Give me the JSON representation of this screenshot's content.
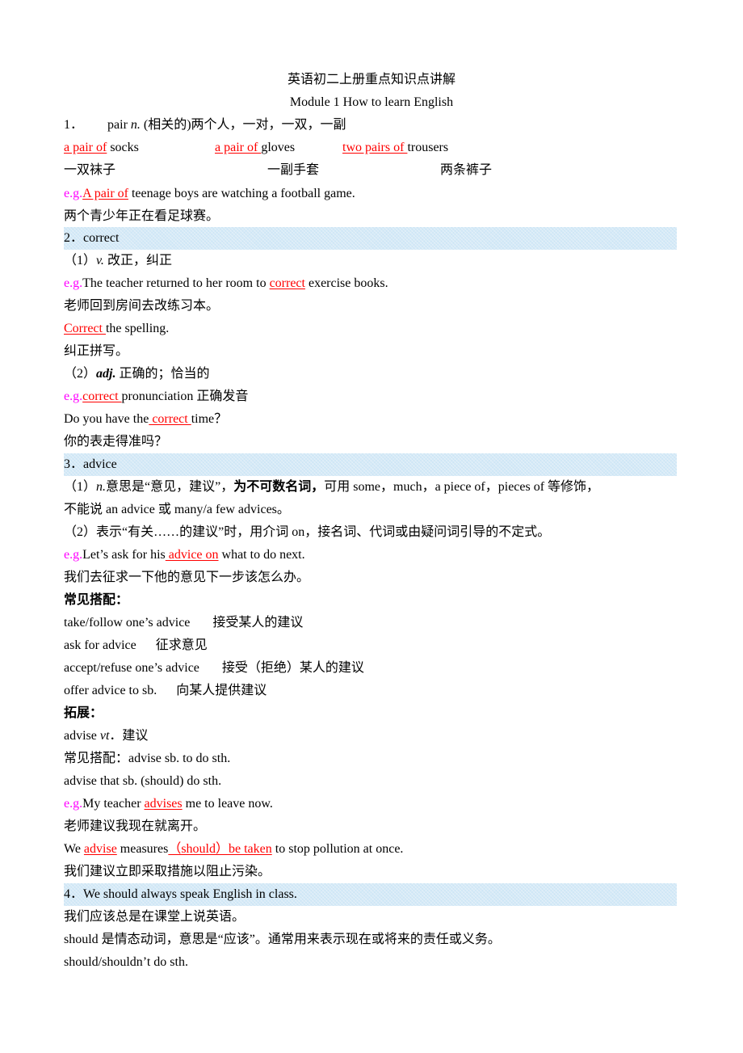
{
  "doc": {
    "title": "英语初二上册重点知识点讲解",
    "subtitle": "Module 1 How to learn English"
  },
  "s1": {
    "num": "1．",
    "word": "pair",
    "pos": "n.",
    "meaning": " (相关的)两个人，一对，一双，一副",
    "ex1_red": "a pair of",
    "ex1_tail": " socks",
    "ex2_red": "a pair of ",
    "ex2_tail": "gloves",
    "ex3_red": "two pairs of ",
    "ex3_tail": "trousers",
    "cn1": "一双袜子",
    "cn2": "一副手套",
    "cn3": "两条裤子",
    "eg": "e.g.",
    "eg_red": "A pair of",
    "eg_tail": " teenage boys are watching a football game.",
    "eg_cn": "两个青少年正在看足球赛。"
  },
  "s2": {
    "header": "2．correct",
    "p1_prefix": "（1）",
    "p1_pos": "v.",
    "p1_meaning": " 改正，纠正",
    "eg": "e.g.",
    "ex1_head": "The teacher returned to her room to ",
    "ex1_red": "correct",
    "ex1_tail": " exercise books.",
    "ex1_cn": "老师回到房间去改练习本。",
    "ex2_red": "Correct ",
    "ex2_tail": "the spelling.",
    "ex2_cn": "纠正拼写。",
    "p2_prefix": "（2）",
    "p2_pos": "adj.",
    "p2_meaning": " 正确的；恰当的",
    "ex3_red": "correct ",
    "ex3_tail": "pronunciation  正确发音",
    "ex4_head": "Do you have the",
    "ex4_red": " correct ",
    "ex4_tail": "time？",
    "ex4_cn": "你的表走得准吗？"
  },
  "s3": {
    "header": "3．advice",
    "p1_prefix": "（1）",
    "p1_pos": "n.",
    "p1_a": "意思是“意见，建议”，",
    "p1_bold": "为不可数名词，",
    "p1_b": "可用 some，much，a piece of，pieces of 等修饰，",
    "p1_c": "不能说 an advice 或 many/a few advices。",
    "p2": "（2）表示“有关……的建议”时，用介词 on，接名词、代词或由疑问词引导的不定式。",
    "eg": "e.g.",
    "ex1_head": "Let’s ask for his",
    "ex1_red": " advice on",
    "ex1_tail": " what to do next.",
    "ex1_cn": "我们去征求一下他的意见下一步该怎么办。",
    "colloc_title": "常见搭配：",
    "collocations": [
      {
        "en": "take/follow one’s advice",
        "cn": "接受某人的建议"
      },
      {
        "en": "ask for advice",
        "cn": "征求意见"
      },
      {
        "en": "accept/refuse one’s advice",
        "cn": "接受（拒绝）某人的建议"
      },
      {
        "en": "offer advice to sb.",
        "cn": "向某人提供建议"
      }
    ],
    "ext_title": "拓展：",
    "ext_word": "advise ",
    "ext_pos": "vt",
    "ext_meaning": "．建议",
    "ext_colloc1": "常见搭配：advise sb. to do sth.",
    "ext_colloc2": "advise that sb. (should) do sth.",
    "ex2_head": "My teacher ",
    "ex2_red": "advises",
    "ex2_tail": " me to leave now.",
    "ex2_cn": "老师建议我现在就离开。",
    "ex3_head": "We ",
    "ex3_red1": "advise",
    "ex3_mid": " measures",
    "ex3_red2": "（should）be taken",
    "ex3_tail": " to stop pollution at once.",
    "ex3_cn": "我们建议立即采取措施以阻止污染。"
  },
  "s4": {
    "header": "4．We should always speak English in class.",
    "cn": "我们应该总是在课堂上说英语。",
    "note": "should 是情态动词，意思是“应该”。通常用来表示现在或将来的责任或义务。",
    "pattern": "should/shouldn’t do sth."
  }
}
